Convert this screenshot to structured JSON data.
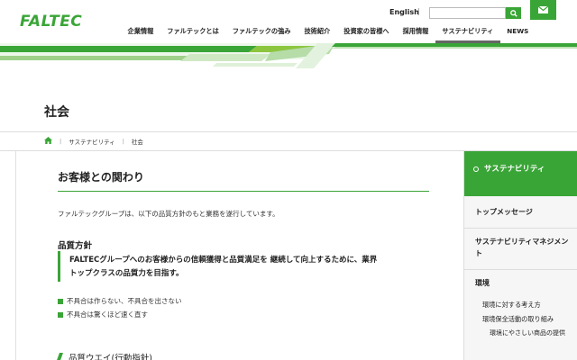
{
  "brand": {
    "logo_text": "FALTEC",
    "accent_color": "#3aa537"
  },
  "header": {
    "lang_link": "English",
    "lang_sep": "|",
    "search": {
      "placeholder": ""
    },
    "nav": [
      {
        "label": "企業情報"
      },
      {
        "label": "ファルテックとは"
      },
      {
        "label": "ファルテックの強み"
      },
      {
        "label": "技術紹介"
      },
      {
        "label": "投資家の皆様へ"
      },
      {
        "label": "採用情報"
      },
      {
        "label": "サステナビリティ",
        "active": true
      },
      {
        "label": "NEWS"
      }
    ]
  },
  "page": {
    "title": "社会"
  },
  "breadcrumb": {
    "items": [
      "サステナビリティ",
      "社会"
    ]
  },
  "main": {
    "section_title": "お客様との関わり",
    "intro": "ファルテックグループは、以下の品質方針のもと業務を遂行しています。",
    "quality_heading": "品質方針",
    "policy_line1": "FALTECグループへのお客様からの信頼獲得と品質満足を 継続して向上するために、業界",
    "policy_line2": "トップクラスの品質力を目指す。",
    "bullets": [
      "不具合は作らない、不具合を出さない",
      "不具合は驚くほど速く直す"
    ],
    "next_heading": "品質ウエイ(行動指針)"
  },
  "sidebar": {
    "head": "サステナビリティ",
    "items": [
      {
        "label": "トップメッセージ"
      },
      {
        "label": "サステナビリティマネジメント"
      },
      {
        "label": "環境"
      }
    ],
    "env_sub": [
      "環境に対する考え方",
      "環境保全活動の取り組み"
    ],
    "env_subsub": "環境にやさしい商品の提供"
  }
}
